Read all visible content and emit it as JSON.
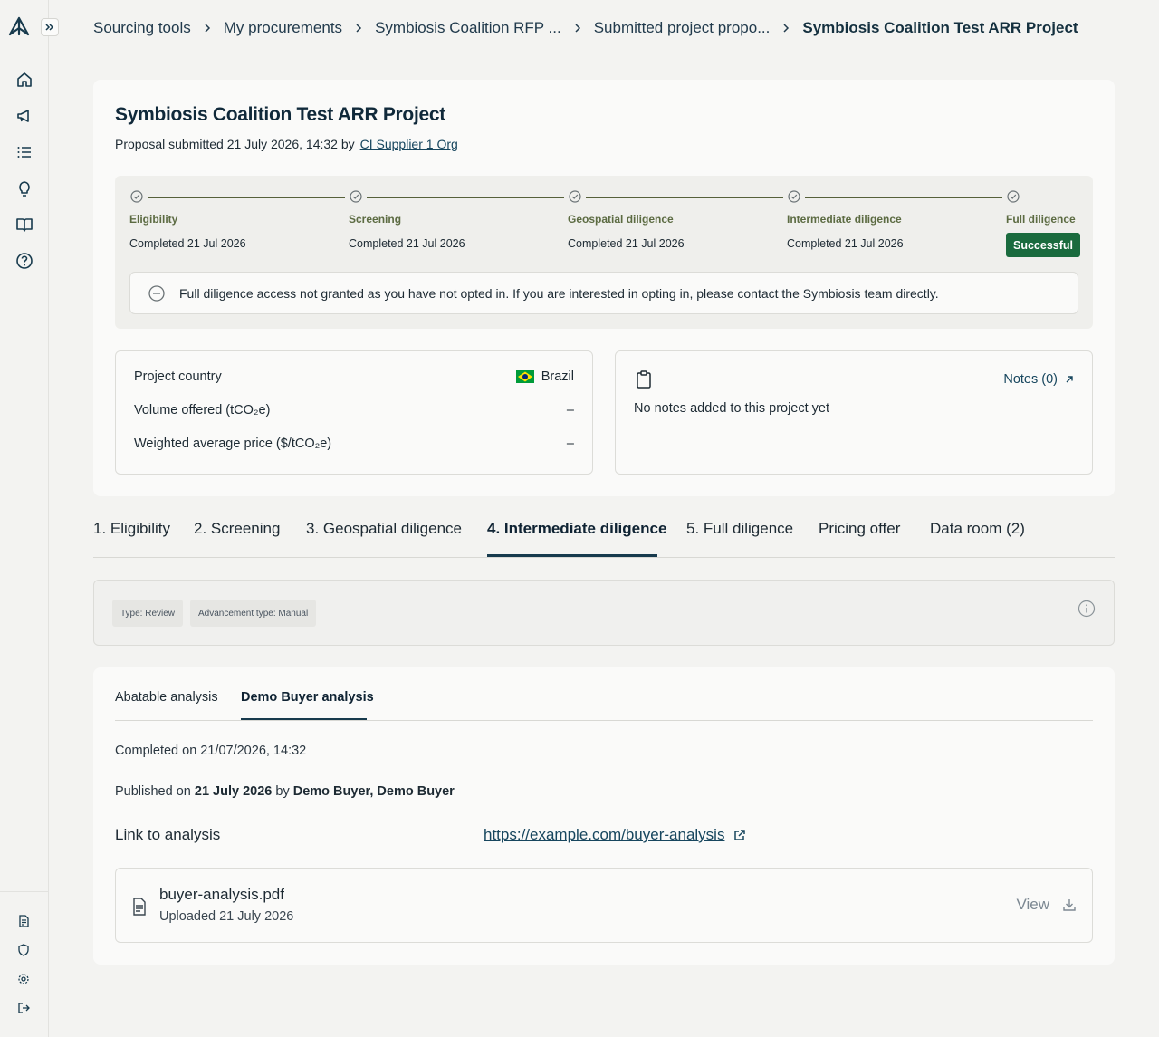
{
  "breadcrumb": {
    "items": [
      "Sourcing tools",
      "My procurements",
      "Symbiosis Coalition RFP ...",
      "Submitted project propo..."
    ],
    "current": "Symbiosis Coalition Test ARR Project"
  },
  "project": {
    "title": "Symbiosis Coalition Test ARR Project",
    "submitted_prefix": "Proposal submitted 21 July 2026, 14:32 by",
    "supplier": "CI Supplier 1 Org"
  },
  "stepper": {
    "steps": [
      {
        "label": "Eligibility",
        "status": "Completed 21 Jul 2026"
      },
      {
        "label": "Screening",
        "status": "Completed 21 Jul 2026"
      },
      {
        "label": "Geospatial diligence",
        "status": "Completed 21 Jul 2026"
      },
      {
        "label": "Intermediate diligence",
        "status": "Completed 21 Jul 2026"
      },
      {
        "label": "Full diligence",
        "status": "Successful"
      }
    ],
    "banner": "Full diligence access not granted as you have not opted in. If you are interested in opting in, please contact the Symbiosis team directly."
  },
  "details": {
    "country_label": "Project country",
    "country_value": "Brazil",
    "volume_label": "Volume offered (tCO₂e)",
    "volume_value": "–",
    "price_label": "Weighted average price ($/tCO₂e)",
    "price_value": "–"
  },
  "notes": {
    "link": "Notes (0)",
    "empty": "No notes added to this project yet"
  },
  "stage_tabs": [
    "1. Eligibility",
    "2. Screening",
    "3. Geospatial diligence",
    "4. Intermediate diligence",
    "5. Full diligence",
    "Pricing offer",
    "Data room (2)"
  ],
  "stage_active": "4. Intermediate diligence",
  "type_chips": [
    "Type: Review",
    "Advancement type: Manual"
  ],
  "analysis": {
    "tabs": [
      "Abatable analysis",
      "Demo Buyer analysis"
    ],
    "active_tab": "Demo Buyer analysis",
    "completed_on": "Completed on 21/07/2026, 14:32",
    "published_prefix": "Published on",
    "published_date": "21 July 2026",
    "published_by_word": "by",
    "published_by": "Demo Buyer, Demo Buyer",
    "link_label": "Link to analysis",
    "link_url": "https://example.com/buyer-analysis",
    "file_name": "buyer-analysis.pdf",
    "file_uploaded": "Uploaded 21 July 2026",
    "view_label": "View"
  },
  "colors": {
    "success": "#1a6b3e",
    "step_line": "#56613a",
    "link": "#17465e"
  },
  "icons": {
    "sidebar": [
      "home-icon",
      "megaphone-icon",
      "list-icon",
      "lightbulb-icon",
      "book-icon",
      "help-icon"
    ],
    "sidebar_bottom": [
      "document-icon",
      "shield-icon",
      "settings-icon",
      "logout-icon"
    ]
  }
}
